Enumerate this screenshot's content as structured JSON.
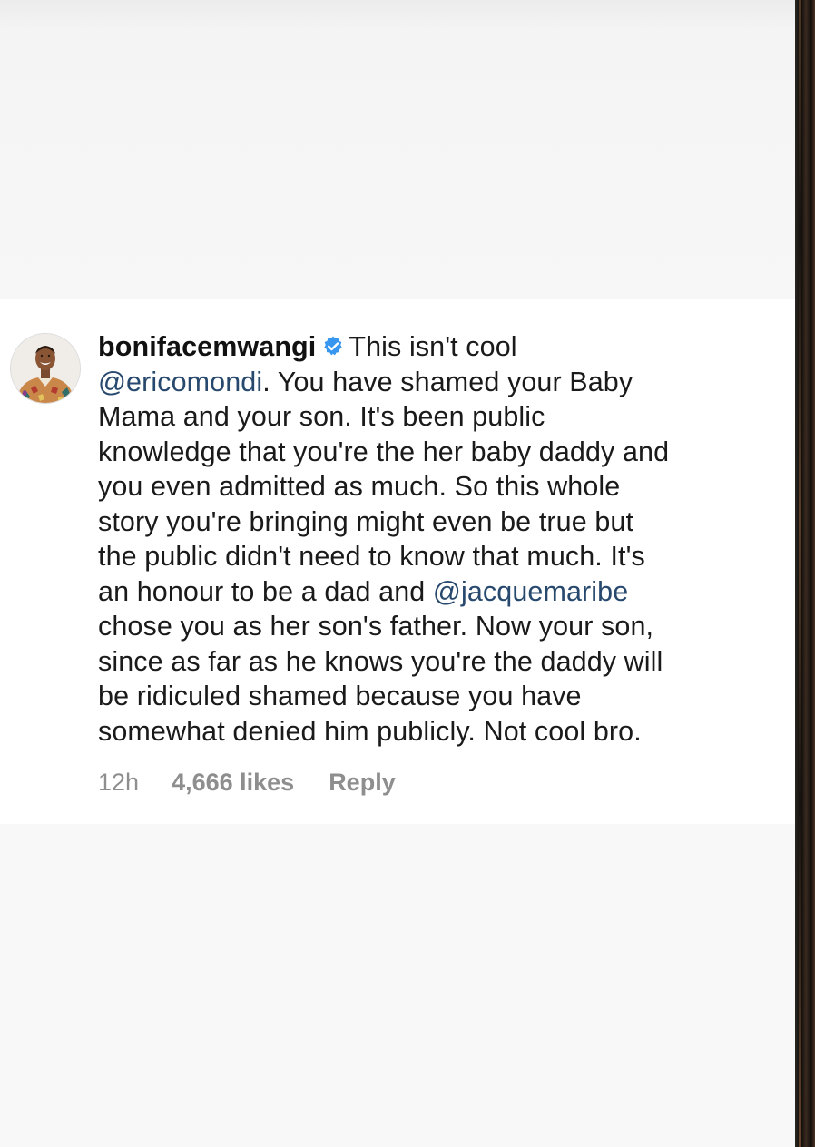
{
  "comment": {
    "username": "bonifacemwangi",
    "verified_icon": "verified-badge-icon",
    "avatar_icon": "user-avatar-photo",
    "accent_colors": {
      "mention": "#28496e",
      "verified": "#3797f0",
      "meta": "#8e8e8e"
    },
    "lines": {
      "l1_text": "This isn't cool",
      "l2_mention": "@ericomondi",
      "l2_text": ". You have shamed your Baby",
      "l3": "Mama and your son. It's been public",
      "l4": "knowledge that you're the her baby daddy and",
      "l5": "you even admitted as much. So this whole",
      "l6": "story you're bringing might even be true but",
      "l7": "the public didn't need to know that much. It's",
      "l8_text": "an honour to be a dad and ",
      "l8_mention": "@jacquemaribe",
      "l9": "chose you as her son's father.  Now your son,",
      "l10": "since as far as he knows you're the daddy will",
      "l11": "be ridiculed shamed because you have",
      "l12": "somewhat denied him publicly. Not cool bro."
    },
    "meta": {
      "time": "12h",
      "likes": "4,666 likes",
      "reply": "Reply"
    }
  }
}
